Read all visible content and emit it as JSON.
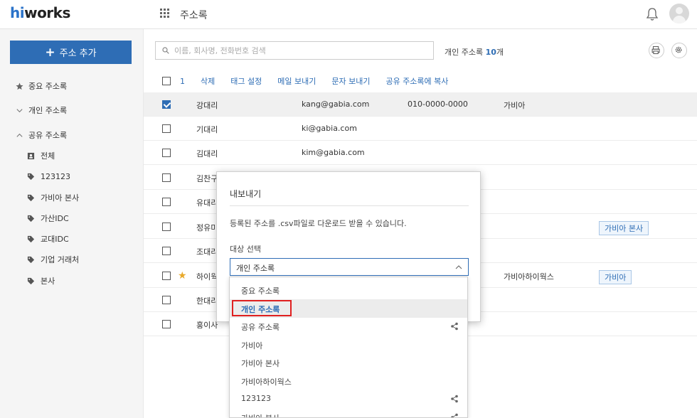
{
  "header": {
    "logo_h": "hi",
    "logo_rest": "works",
    "app_title": "주소록"
  },
  "sidebar": {
    "add_button": "주소 추가",
    "items": [
      {
        "label": "중요 주소록",
        "icon": "star-icon"
      },
      {
        "label": "개인 주소록",
        "icon": "chevron-down-icon"
      },
      {
        "label": "공유 주소록",
        "icon": "chevron-up-icon"
      }
    ],
    "shared_items": [
      {
        "label": "전체",
        "icon": "contact-card-icon"
      },
      {
        "label": "123123",
        "icon": "tag-icon"
      },
      {
        "label": "가비아 본사",
        "icon": "tag-icon"
      },
      {
        "label": "가산IDC",
        "icon": "tag-icon"
      },
      {
        "label": "교대IDC",
        "icon": "tag-icon"
      },
      {
        "label": "기업 거래처",
        "icon": "tag-icon"
      },
      {
        "label": "본사",
        "icon": "tag-icon"
      }
    ]
  },
  "main": {
    "search_placeholder": "이름, 회사명, 전화번호 검색",
    "count_label": "개인 주소록",
    "count_value": "10",
    "count_unit": "개",
    "toolbar": {
      "selected_count": "1",
      "actions": [
        "삭제",
        "태그 설정",
        "메일 보내기",
        "문자 보내기",
        "공유 주소록에 복사"
      ]
    },
    "rows": [
      {
        "name": "강대리",
        "email": "kang@gabia.com",
        "phone": "010-0000-0000",
        "company": "가비아",
        "tag": "",
        "checked": true,
        "starred": false
      },
      {
        "name": "기대리",
        "email": "ki@gabia.com",
        "phone": "",
        "company": "",
        "tag": "",
        "checked": false,
        "starred": false
      },
      {
        "name": "김대리",
        "email": "kim@gabia.com",
        "phone": "",
        "company": "",
        "tag": "",
        "checked": false,
        "starred": false
      },
      {
        "name": "김찬구",
        "email": "",
        "phone": "",
        "company": "",
        "tag": "",
        "checked": false,
        "starred": false
      },
      {
        "name": "유대리",
        "email": "",
        "phone": "",
        "company": "",
        "tag": "",
        "checked": false,
        "starred": false
      },
      {
        "name": "정유미",
        "email": "",
        "phone": "",
        "company": "",
        "tag": "가비아 본사",
        "checked": false,
        "starred": false
      },
      {
        "name": "조대리",
        "email": "",
        "phone": "",
        "company": "",
        "tag": "",
        "checked": false,
        "starred": false
      },
      {
        "name": "하이웍",
        "email": "",
        "phone": "",
        "company": "가비아하이웍스",
        "tag": "가비아",
        "checked": false,
        "starred": true
      },
      {
        "name": "한대리",
        "email": "",
        "phone": "",
        "company": "",
        "tag": "",
        "checked": false,
        "starred": false
      },
      {
        "name": "홍이사",
        "email": "",
        "phone": "",
        "company": "",
        "tag": "",
        "checked": false,
        "starred": false
      }
    ]
  },
  "modal": {
    "title": "내보내기",
    "description": "등록된 주소를 .csv파일로 다운로드 받을 수 있습니다.",
    "target_label": "대상 선택",
    "selected_value": "개인 주소록",
    "options": [
      {
        "label": "중요 주소록",
        "shared": false,
        "highlighted": false
      },
      {
        "label": "개인 주소록",
        "shared": false,
        "highlighted": true
      },
      {
        "label": "공유 주소록",
        "shared": true,
        "highlighted": false
      },
      {
        "label": "가비아",
        "shared": false,
        "highlighted": false
      },
      {
        "label": "가비아 본사",
        "shared": false,
        "highlighted": false
      },
      {
        "label": "가비아하이웍스",
        "shared": false,
        "highlighted": false
      },
      {
        "label": "123123",
        "shared": true,
        "highlighted": false
      },
      {
        "label": "가비아 본사",
        "shared": true,
        "highlighted": false
      }
    ]
  },
  "colors": {
    "accent": "#2e6db5",
    "highlight_border": "#e02020",
    "star": "#e8a92a"
  }
}
